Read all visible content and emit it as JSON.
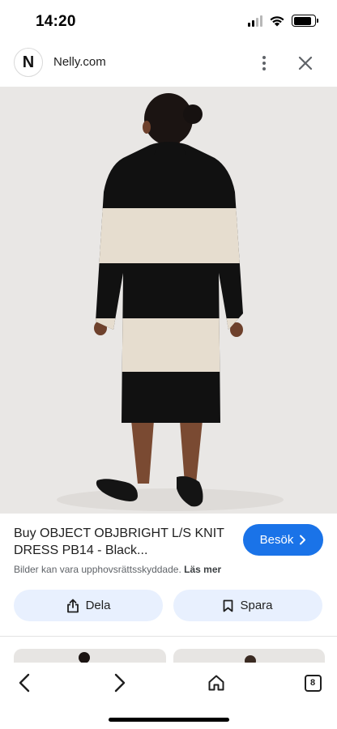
{
  "status_bar": {
    "time": "14:20",
    "icons": [
      "cellular-signal-icon",
      "wifi-icon",
      "battery-icon"
    ],
    "battery_level": 0.85
  },
  "site": {
    "logo_letter": "N",
    "name": "Nelly.com",
    "icons": [
      "more-vertical-icon",
      "close-icon"
    ]
  },
  "product": {
    "title": "Buy OBJECT OBJBRIGHT L/S KNIT DRESS PB14 - Black...",
    "visit_label": "Besök",
    "copyright_text": "Bilder kan vara upphovsrättsskyddade.",
    "read_more_label": "Läs mer",
    "share_label": "Dela",
    "save_label": "Spara"
  },
  "toolbar": {
    "tab_count": "8",
    "icons": [
      "back-icon",
      "forward-icon",
      "home-icon",
      "tabs-icon"
    ]
  },
  "colors": {
    "accent": "#1a73e8",
    "action_button_bg": "#e8f0fe",
    "image_bg": "#e9e7e5",
    "dress_black": "#111111",
    "dress_cream": "#e6ddcf"
  }
}
